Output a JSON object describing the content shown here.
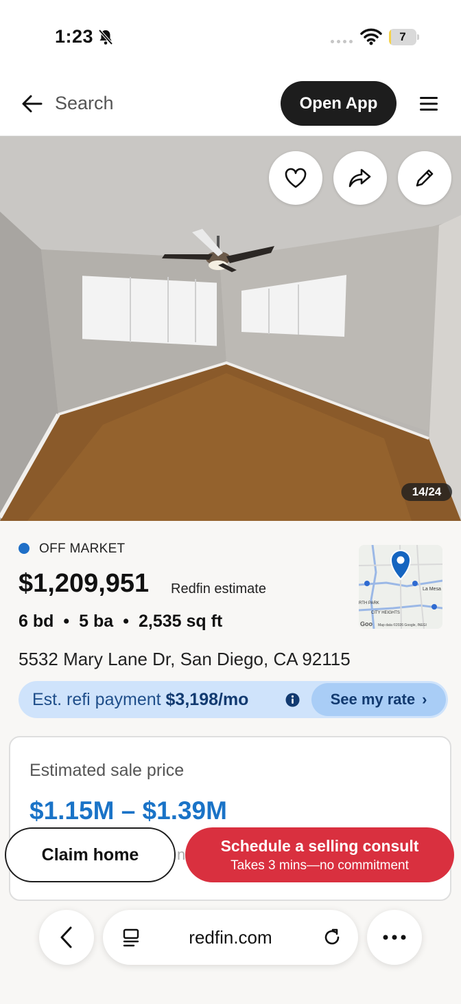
{
  "status_bar": {
    "time": "1:23",
    "battery_level": "7",
    "battery_fraction": 0.07,
    "icons": [
      "bell-slash-icon",
      "signal-icon",
      "wifi-icon",
      "battery-icon"
    ]
  },
  "header": {
    "back_icon": "back-arrow-icon",
    "search_label": "Search",
    "open_app_label": "Open App",
    "menu_icon": "hamburger-menu-icon"
  },
  "photo": {
    "counter": "14/24",
    "actions": [
      "heart-icon",
      "share-icon",
      "edit-icon"
    ]
  },
  "listing": {
    "status": "OFF MARKET",
    "status_color": "#1f6fc7",
    "price": "$1,209,951",
    "price_note": "Redfin estimate",
    "beds": "6 bd",
    "baths": "5 ba",
    "sqft": "2,535 sq ft",
    "bullet": "•",
    "address": "5532 Mary Lane Dr, San Diego, CA 92115"
  },
  "map": {
    "labels": [
      "La Mesa",
      "RTH PARK",
      "CITY HEIGHTS",
      "Map data ©2026 Google, INEGI",
      "Goo"
    ]
  },
  "refi": {
    "prefix": "Est. refi payment",
    "amount": "$3,198/mo",
    "button_label": "See my rate",
    "chevron": "›"
  },
  "estimate_card": {
    "label": "Estimated sale price",
    "range": "$1.15M – $1.39M",
    "hidden_text": "n"
  },
  "cta": {
    "claim_label": "Claim home",
    "consult_title": "Schedule a selling consult",
    "consult_sub": "Takes 3 mins—no commitment",
    "consult_color": "#d9303f"
  },
  "browser": {
    "url": "redfin.com",
    "icons": [
      "chevron-left-icon",
      "reader-mode-icon",
      "reload-icon",
      "more-icon"
    ]
  }
}
